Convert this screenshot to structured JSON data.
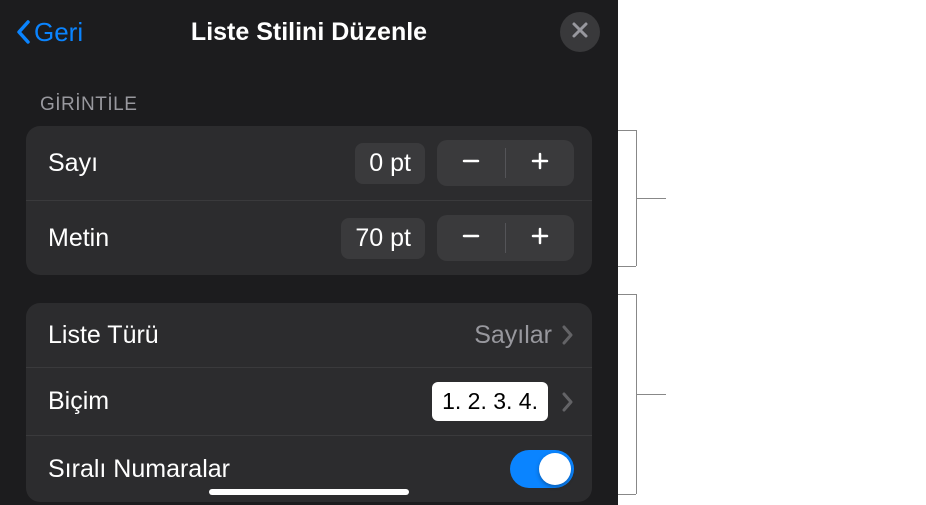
{
  "header": {
    "back_label": "Geri",
    "title": "Liste Stilini Düzenle"
  },
  "sections": {
    "indent": {
      "title": "GİRİNTİLE",
      "number": {
        "label": "Sayı",
        "value": "0 pt"
      },
      "text": {
        "label": "Metin",
        "value": "70 pt"
      }
    },
    "list": {
      "type": {
        "label": "Liste Türü",
        "value": "Sayılar"
      },
      "format": {
        "label": "Biçim",
        "value": "1. 2. 3. 4."
      },
      "tiered": {
        "label": "Sıralı Numaralar"
      }
    }
  }
}
